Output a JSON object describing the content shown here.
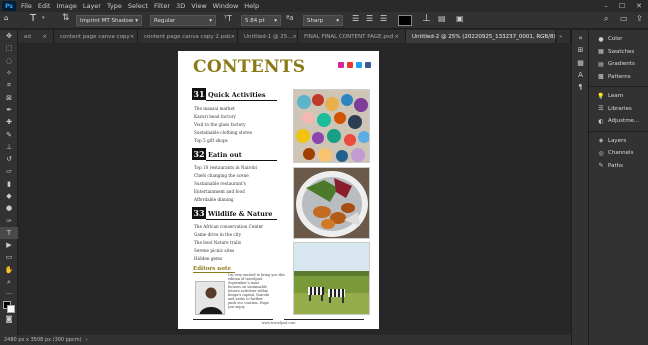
{
  "menu": {
    "app": "Ps",
    "items": [
      "File",
      "Edit",
      "Image",
      "Layer",
      "Type",
      "Select",
      "Filter",
      "3D",
      "View",
      "Window",
      "Help"
    ]
  },
  "options": {
    "tool_glyph": "T",
    "font_family": "Imprint MT Shadow",
    "font_style": "Regular",
    "font_size": "5.84 pt",
    "antialias": "Sharp",
    "text_color": "#000000"
  },
  "tabs": [
    "ed",
    "content page canva copy",
    "content page canva copy 2.psb",
    "Untitled-1 @ 25...",
    "FINAL FINAL CONTENT PAGE.psd",
    "Untitled-2 @ 25% (20220925_133237_0001, RGB/8) *"
  ],
  "status": "2480 px x 3508 px (300 ppcm)",
  "panels": [
    {
      "label": "Color",
      "icon": "●"
    },
    {
      "label": "Swatches",
      "icon": "▦"
    },
    {
      "label": "Gradients",
      "icon": "▤"
    },
    {
      "label": "Patterns",
      "icon": "▩"
    },
    {
      "label": "Learn",
      "icon": "💡"
    },
    {
      "label": "Libraries",
      "icon": "☰"
    },
    {
      "label": "Adjustme...",
      "icon": "◐"
    },
    {
      "label": "Layers",
      "icon": "◈"
    },
    {
      "label": "Channels",
      "icon": "◎"
    },
    {
      "label": "Paths",
      "icon": "✎"
    }
  ],
  "doc": {
    "title": "CONTENTS",
    "sections": [
      {
        "num": "31",
        "heading": "Quick Activities",
        "items": [
          "The maasai market",
          "Kazuri bead factory",
          "Visit to the glass factory",
          "Sustainable clothing stores",
          "Top 5 gift shops"
        ]
      },
      {
        "num": "32",
        "heading": "Eatin out",
        "items": [
          "Top 10 restaurants in Nairobi",
          "Chefs changing the scene",
          "Sustainable restaurant's",
          "Entertainment and food",
          "Affordable dinning"
        ]
      },
      {
        "num": "33",
        "heading": "Wildlife & Nature",
        "items": [
          "The African conservation Center",
          "Game drive in the city",
          "The best Nature trails",
          "Serene picnic sites",
          "Hidden gems"
        ]
      }
    ],
    "editor": {
      "heading": "Editors note",
      "intro": [
        "I'm very excited to bring you this",
        "edition of travelpad,"
      ],
      "body": [
        "September's issue",
        "focuses on sustainable",
        "leisure activities within",
        "Kenya's capital, Nairobi",
        "and seeks to further",
        "push eco tourism. Hope",
        "you enjoy."
      ]
    },
    "footer": "www.travelpad.com"
  },
  "colors": {
    "title_gold": "#8a7a16",
    "ps_blue": "#31a8ff"
  }
}
